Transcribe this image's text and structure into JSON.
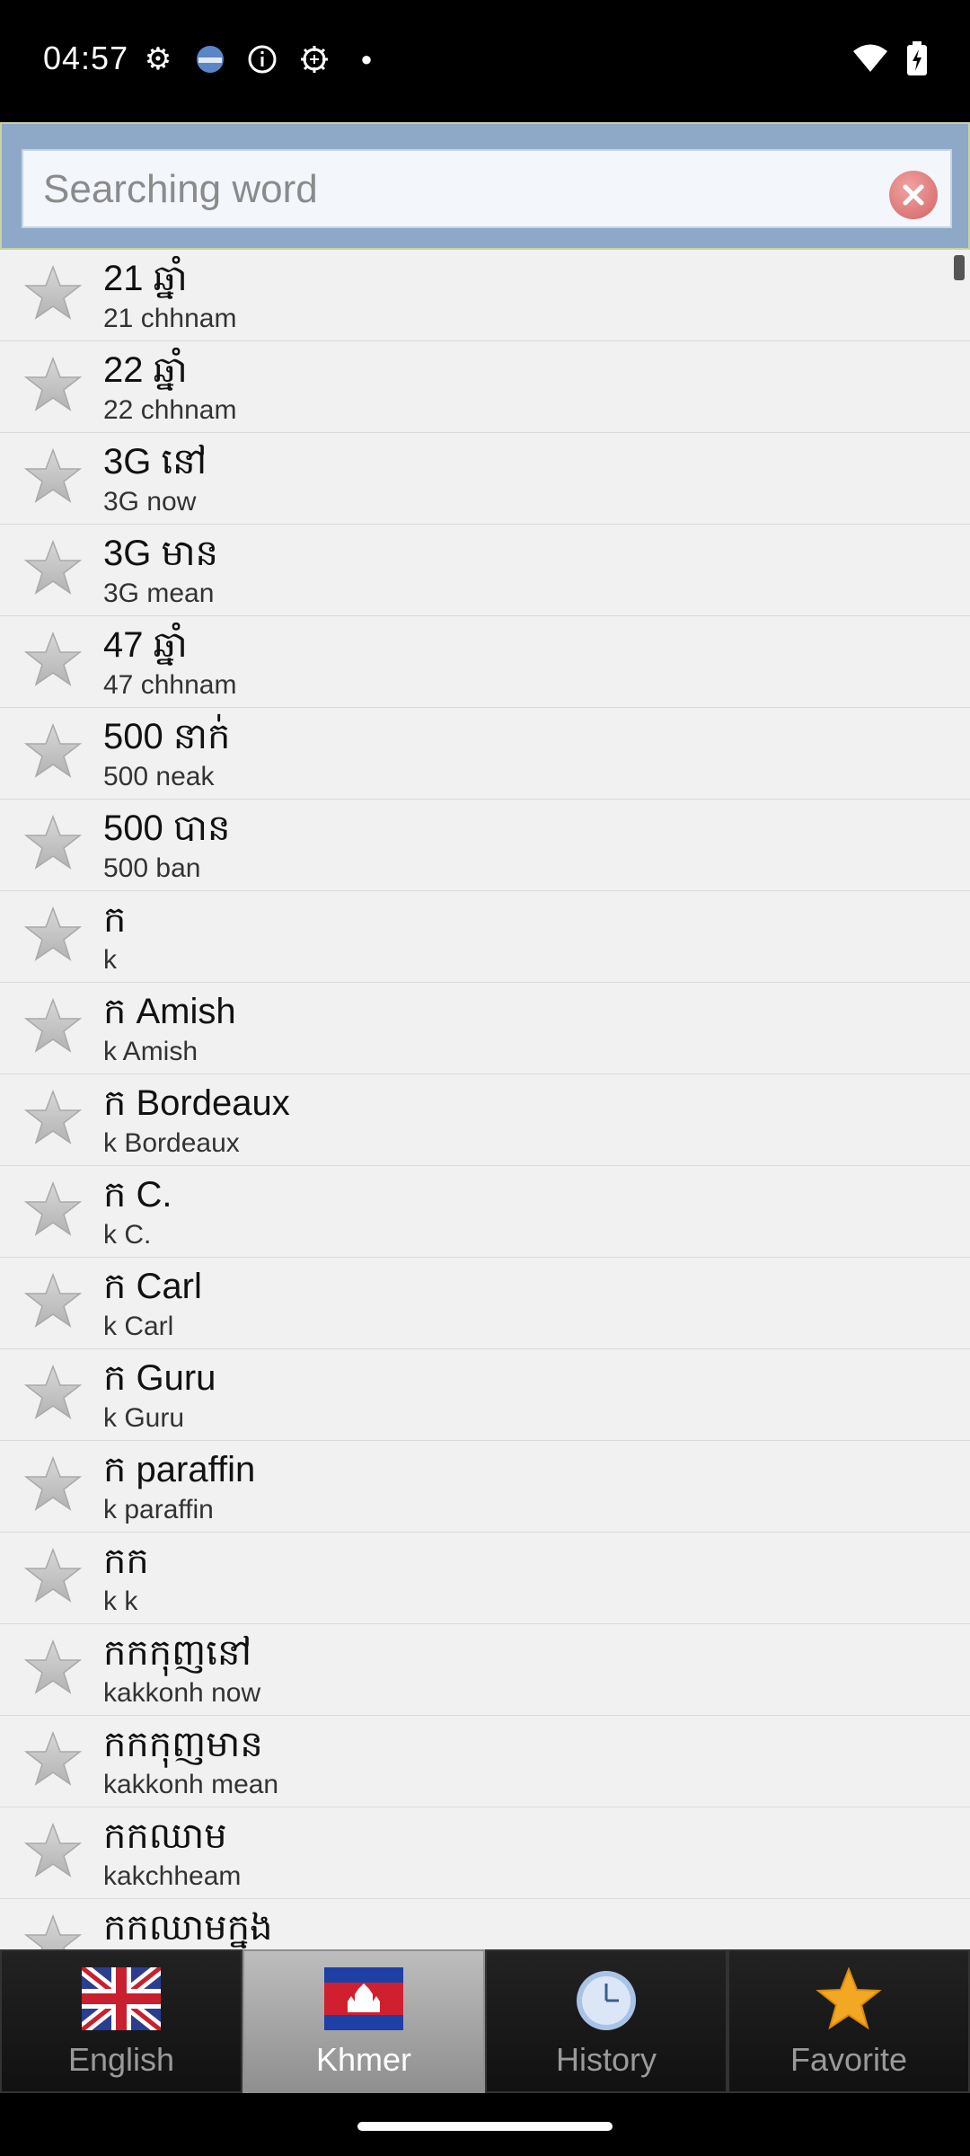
{
  "status_bar": {
    "time": "04:57"
  },
  "search": {
    "placeholder": "Searching word"
  },
  "entries": [
    {
      "word": "21 ឆ្នាំ",
      "translit": "21  chhnam"
    },
    {
      "word": "22 ឆ្នាំ",
      "translit": "22  chhnam"
    },
    {
      "word": "3G នៅ",
      "translit": "3G  now"
    },
    {
      "word": "3G មាន",
      "translit": "3G  mean"
    },
    {
      "word": "47 ឆ្នាំ",
      "translit": "47  chhnam"
    },
    {
      "word": "500 នាក់",
      "translit": "500  neak"
    },
    {
      "word": "500 បាន",
      "translit": "500  ban"
    },
    {
      "word": "ក",
      "translit": "k"
    },
    {
      "word": "ក Amish",
      "translit": "k Amish"
    },
    {
      "word": "ក Bordeaux",
      "translit": "k Bordeaux"
    },
    {
      "word": "ក C.",
      "translit": "k C."
    },
    {
      "word": "ក Carl",
      "translit": "k Carl"
    },
    {
      "word": "ក Guru",
      "translit": "k Guru"
    },
    {
      "word": "ក paraffin",
      "translit": "k paraffin"
    },
    {
      "word": "កក",
      "translit": "k k"
    },
    {
      "word": "កកកុញនៅ",
      "translit": "kakkonh now"
    },
    {
      "word": "កកកុញមាន",
      "translit": "kakkonh mean"
    },
    {
      "word": "កកឈាម",
      "translit": "kakchheam"
    },
    {
      "word": "កកឈាមក្នុង",
      "translit": ""
    }
  ],
  "tabs": [
    {
      "label": "English",
      "icon": "uk-flag-icon",
      "active": false
    },
    {
      "label": "Khmer",
      "icon": "cambodia-flag-icon",
      "active": true
    },
    {
      "label": "History",
      "icon": "clock-icon",
      "active": false
    },
    {
      "label": "Favorite",
      "icon": "star-icon",
      "active": false
    }
  ]
}
